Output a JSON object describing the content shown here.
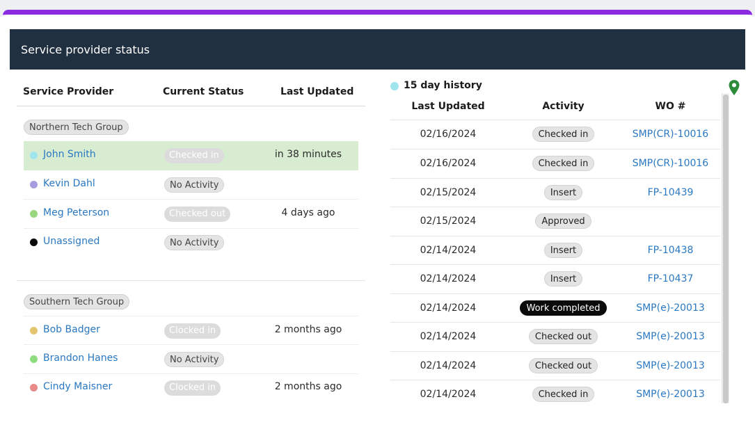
{
  "panel": {
    "title": "Service provider status"
  },
  "left_headers": {
    "provider": "Service Provider",
    "status": "Current Status",
    "updated": "Last Updated"
  },
  "groups": [
    {
      "name": "Northern Tech Group",
      "rows": [
        {
          "name": "John Smith",
          "dot": "#9fe5ee",
          "status": "Checked in",
          "updated": "in 38 minutes"
        },
        {
          "name": "Kevin Dahl",
          "dot": "#a79ce0",
          "status": "No Activity",
          "updated": ""
        },
        {
          "name": "Meg Peterson",
          "dot": "#98d67f",
          "status": "Checked out",
          "updated": "4 days ago"
        },
        {
          "name": "Unassigned",
          "dot": "#0a0a0a",
          "status": "No Activity",
          "updated": ""
        }
      ]
    },
    {
      "name": "Southern Tech Group",
      "rows": [
        {
          "name": "Bob Badger",
          "dot": "#e3c46f",
          "status": "Clocked in",
          "updated": "2 months ago"
        },
        {
          "name": "Brandon Hanes",
          "dot": "#8ddc7f",
          "status": "No Activity",
          "updated": ""
        },
        {
          "name": "Cindy Maisner",
          "dot": "#e88a8a",
          "status": "Clocked in",
          "updated": "2 months ago"
        }
      ]
    }
  ],
  "history": {
    "label": "15 day history",
    "headers": {
      "date": "Last Updated",
      "activity": "Activity",
      "wo": "WO #"
    },
    "rows": [
      {
        "date": "02/16/2024",
        "activity": "Checked in",
        "wo": "SMP(CR)-10016"
      },
      {
        "date": "02/16/2024",
        "activity": "Checked in",
        "wo": "SMP(CR)-10016"
      },
      {
        "date": "02/15/2024",
        "activity": "Insert",
        "wo": "FP-10439"
      },
      {
        "date": "02/15/2024",
        "activity": "Approved",
        "wo": ""
      },
      {
        "date": "02/14/2024",
        "activity": "Insert",
        "wo": "FP-10438"
      },
      {
        "date": "02/14/2024",
        "activity": "Insert",
        "wo": "FP-10437"
      },
      {
        "date": "02/14/2024",
        "activity": "Work completed",
        "wo": "SMP(e)-20013"
      },
      {
        "date": "02/14/2024",
        "activity": "Checked out",
        "wo": "SMP(e)-20013"
      },
      {
        "date": "02/14/2024",
        "activity": "Checked out",
        "wo": "SMP(e)-20013"
      },
      {
        "date": "02/14/2024",
        "activity": "Checked in",
        "wo": "SMP(e)-20013"
      }
    ]
  },
  "colors": {
    "accent": "#8a2be2",
    "header_bg": "#213040",
    "link": "#2a78c2",
    "highlight_row": "#d8ecd2",
    "pin": "#2e8b3a"
  },
  "icons": {
    "location": "map-pin-icon"
  }
}
